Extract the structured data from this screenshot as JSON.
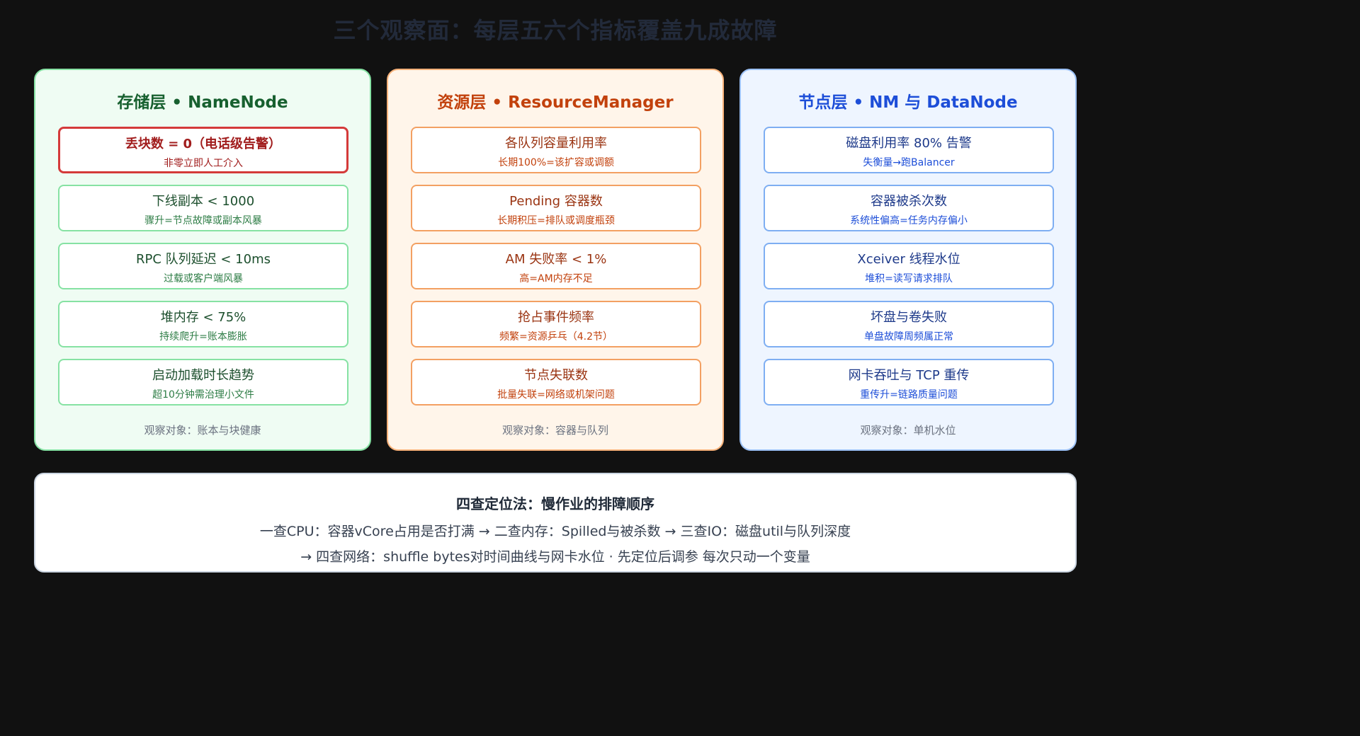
{
  "title": "三个观察面：每层五六个指标覆盖九成故障",
  "panels": [
    {
      "title": "存储层 • NameNode",
      "footer": "观察对象：账本与块健康",
      "cards": [
        {
          "main": "丢块数 = 0（电话级告警）",
          "sub": "非零立即人工介入"
        },
        {
          "main": "下线副本 < 1000",
          "sub": "骤升=节点故障或副本风暴"
        },
        {
          "main": "RPC 队列延迟 < 10ms",
          "sub": "过载或客户端风暴"
        },
        {
          "main": "堆内存 < 75%",
          "sub": "持续爬升=账本膨胀"
        },
        {
          "main": "启动加载时长趋势",
          "sub": "超10分钟需治理小文件"
        }
      ]
    },
    {
      "title": "资源层 • ResourceManager",
      "footer": "观察对象：容器与队列",
      "cards": [
        {
          "main": "各队列容量利用率",
          "sub": "长期100%=该扩容或调额"
        },
        {
          "main": "Pending 容器数",
          "sub": "长期积压=排队或调度瓶颈"
        },
        {
          "main": "AM 失败率 < 1%",
          "sub": "高=AM内存不足"
        },
        {
          "main": "抢占事件频率",
          "sub": "频繁=资源乒乓（4.2节）"
        },
        {
          "main": "节点失联数",
          "sub": "批量失联=网络或机架问题"
        }
      ]
    },
    {
      "title": "节点层 • NM 与 DataNode",
      "footer": "观察对象：单机水位",
      "cards": [
        {
          "main": "磁盘利用率 80% 告警",
          "sub": "失衡量→跑Balancer"
        },
        {
          "main": "容器被杀次数",
          "sub": "系统性偏高=任务内存偏小"
        },
        {
          "main": "Xceiver 线程水位",
          "sub": "堆积=读写请求排队"
        },
        {
          "main": "坏盘与卷失败",
          "sub": "单盘故障周频属正常"
        },
        {
          "main": "网卡吞吐与 TCP 重传",
          "sub": "重传升=链路质量问题"
        }
      ]
    }
  ],
  "bottom": {
    "title": "四查定位法：慢作业的排障顺序",
    "line1": "一查CPU：容器vCore占用是否打满 → 二查内存：Spilled与被杀数 → 三查IO：磁盘util与队列深度",
    "line2": "→ 四查网络：shuffle bytes对时间曲线与网卡水位 · 先定位后调参 每次只动一个变量"
  }
}
